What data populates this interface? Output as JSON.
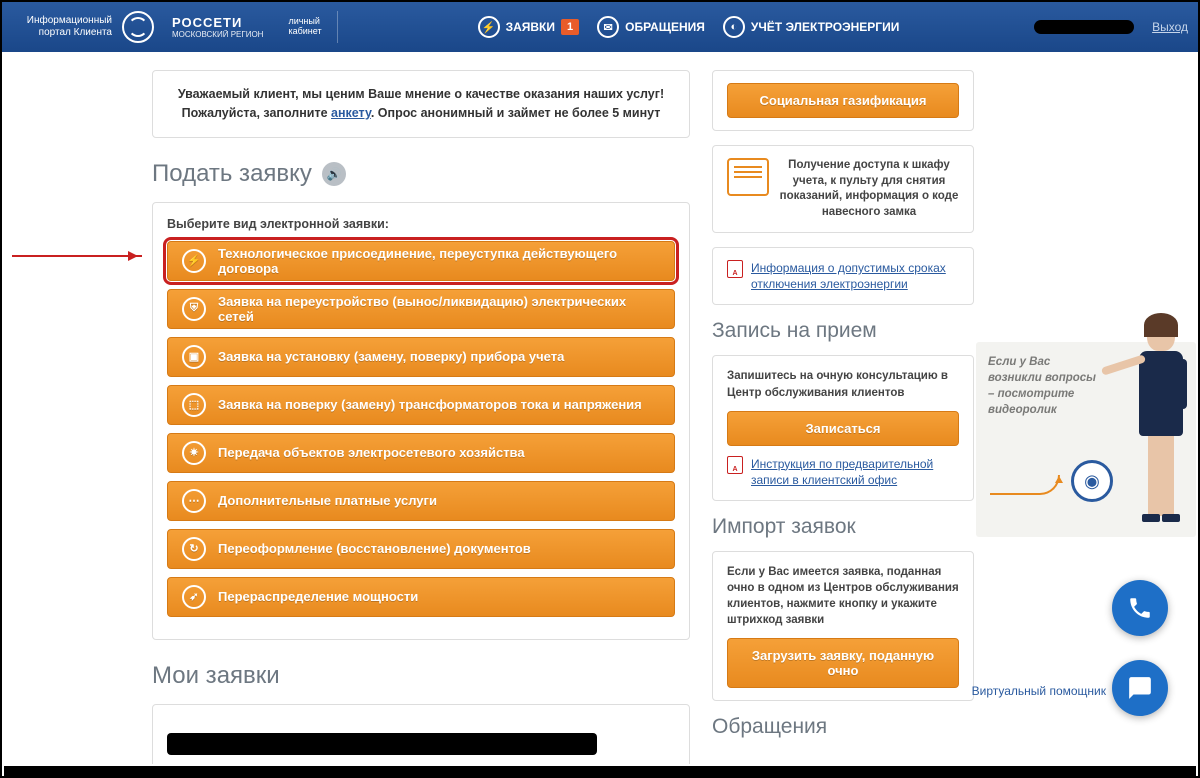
{
  "header": {
    "info": "Информационный портал Клиента",
    "brand": "РОССЕТИ",
    "brand_sub": "МОСКОВСКИЙ РЕГИОН",
    "cabinet_l1": "личный",
    "cabinet_l2": "кабинет",
    "nav_apps": "ЗАЯВКИ",
    "nav_apps_badge": "1",
    "nav_msgs": "ОБРАЩЕНИЯ",
    "nav_meter": "УЧЁТ ЭЛЕКТРОЭНЕРГИИ",
    "logout": "Выход"
  },
  "banner": {
    "l1a": "Уважаемый клиент, мы ценим Ваше мнение о качестве оказания наших услуг!",
    "l2a": "Пожалуйста, заполните ",
    "l2link": "анкету",
    "l2b": ". Опрос анонимный и займет не более 5 минут"
  },
  "main": {
    "title": "Подать заявку",
    "panel_title": "Выберите вид электронной заявки:",
    "my_apps": "Мои заявки"
  },
  "options": [
    {
      "icon": "⚡",
      "label": "Технологическое присоединение, переуступка действующего договора"
    },
    {
      "icon": "⛨",
      "label": "Заявка на переустройство (вынос/ликвидацию) электрических сетей"
    },
    {
      "icon": "▣",
      "label": "Заявка на установку (замену, поверку) прибора учета"
    },
    {
      "icon": "⬚",
      "label": "Заявка на поверку (замену) трансформаторов тока и напряжения"
    },
    {
      "icon": "✷",
      "label": "Передача объектов электросетевого хозяйства"
    },
    {
      "icon": "⋯",
      "label": "Дополнительные платные услуги"
    },
    {
      "icon": "↻",
      "label": "Переоформление (восстановление) документов"
    },
    {
      "icon": "➶",
      "label": "Перераспределение мощности"
    }
  ],
  "side": {
    "gas": "Социальная газификация",
    "cabinet_info": "Получение доступа к шкафу учета, к пульту для снятия показаний, информация о коде навесного замка",
    "outage_link": "Информация о допустимых сроках отключения электроэнергии",
    "appoint_h": "Запись на прием",
    "appoint_txt": "Запишитесь на очную консультацию в Центр обслуживания клиентов",
    "appoint_btn": "Записаться",
    "appoint_link": "Инструкция по предварительной записи в клиентский офис",
    "import_h": "Импорт заявок",
    "import_txt": "Если у Вас имеется заявка, поданная очно в одном из Центров обслуживания клиентов, нажмите кнопку и укажите штрихкод заявки",
    "import_btn": "Загрузить заявку, поданную очно",
    "msgs_h": "Обращения",
    "assistant": "Если у Вас возникли вопросы – посмотрите видеоролик",
    "va": "Виртуальный помощник"
  }
}
